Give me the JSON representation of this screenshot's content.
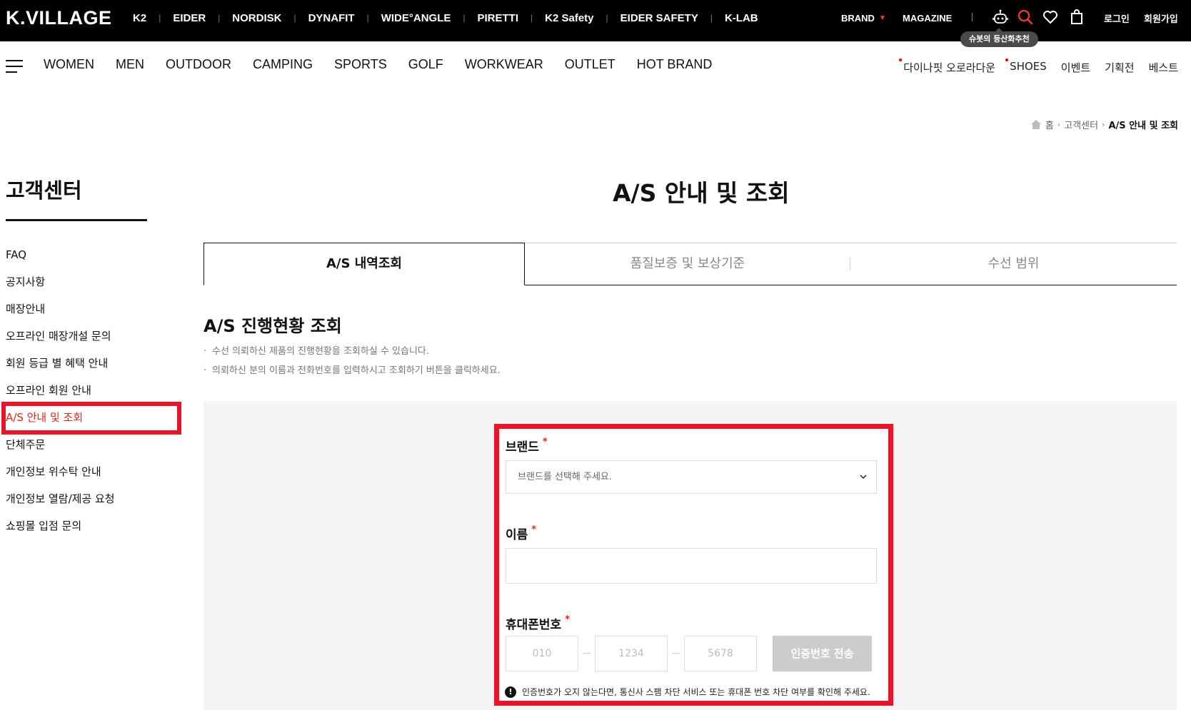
{
  "header": {
    "logo": "K.VILLAGE",
    "brands": [
      "K2",
      "EIDER",
      "NORDISK",
      "DYNAFIT",
      "WIDE°ANGLE",
      "PIRETTI",
      "K2 Safety",
      "EIDER SAFETY",
      "K-LAB"
    ],
    "brand_menu": "BRAND",
    "magazine": "MAGAZINE",
    "login": "로그인",
    "signup": "회원가입",
    "tooltip": "슈봇의 등산화추천"
  },
  "catnav": {
    "items": [
      "WOMEN",
      "MEN",
      "OUTDOOR",
      "CAMPING",
      "SPORTS",
      "GOLF",
      "WORKWEAR",
      "OUTLET",
      "HOT BRAND"
    ],
    "right": [
      "다이나핏 오로라다운",
      "SHOES",
      "이벤트",
      "기획전",
      "베스트"
    ]
  },
  "breadcrumb": {
    "home": "홈",
    "level1": "고객센터",
    "current": "A/S 안내 및 조회"
  },
  "sidebar": {
    "title": "고객센터",
    "items": [
      "FAQ",
      "공지사항",
      "매장안내",
      "오프라인 매장개설 문의",
      "회원 등급 별 혜택 안내",
      "오프라인 회원 안내",
      "A/S 안내 및 조회",
      "단체주문",
      "개인정보 위수탁 안내",
      "개인정보 열람/제공 요청",
      "쇼핑몰 입점 문의"
    ],
    "active_index": 6
  },
  "main": {
    "title": "A/S 안내 및 조회",
    "tabs": [
      "A/S 내역조회",
      "품질보증 및 보상기준",
      "수선 범위"
    ],
    "section_title": "A/S 진행현황 조회",
    "notes": [
      "수선 의뢰하신 제품의 진행현황을 조회하실 수 있습니다.",
      "의뢰하신 분의 이름과 전화번호를 입력하시고 조회하기 버튼을 클릭하세요."
    ]
  },
  "form": {
    "brand_label": "브랜드",
    "brand_placeholder": "브랜드를 선택해 주세요.",
    "name_label": "이름",
    "phone_label": "휴대폰번호",
    "phone1_placeholder": "010",
    "phone2_placeholder": "1234",
    "phone3_placeholder": "5678",
    "send_button": "인증번호 전송",
    "warning": "인증번호가 오지 않는다면, 통신사 스팸 차단 서비스 또는 휴대폰 번호 차단 여부를 확인해 주세요.",
    "required_mark": "*"
  },
  "colors": {
    "accent_red": "#e8142a",
    "header_bg": "#000000",
    "panel_bg": "#f5f5f5",
    "button_disabled": "#cccccc"
  }
}
